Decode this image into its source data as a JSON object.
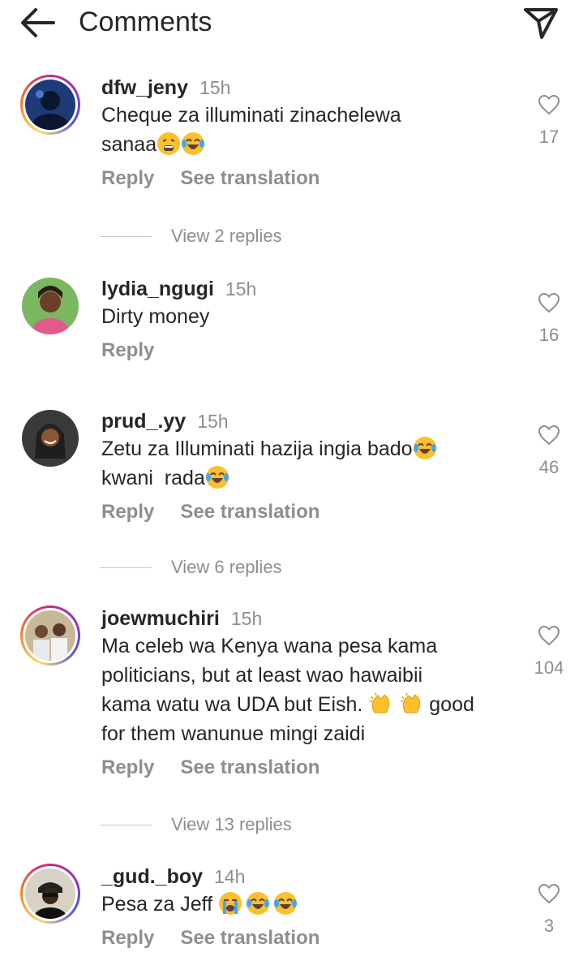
{
  "header": {
    "title": "Comments",
    "back_icon": "arrow-left-icon",
    "send_icon": "paper-plane-icon"
  },
  "colors": {
    "text": "#262626",
    "secondary": "#8e8e8e",
    "divider": "#c7c7c7"
  },
  "comments": [
    {
      "username": "dfw_jeny",
      "time": "15h",
      "lines": [
        "Cheque za illuminati zinachelewa",
        "sanaa"
      ],
      "emojis": [
        "tired-face-emoji",
        "tears-of-joy-emoji"
      ],
      "reply_label": "Reply",
      "translate_label": "See translation",
      "likes": "17",
      "view_replies": "View 2 replies"
    },
    {
      "username": "lydia_ngugi",
      "time": "15h",
      "lines": [
        "Dirty money"
      ],
      "reply_label": "Reply",
      "likes": "16"
    },
    {
      "username": "prud_.yy",
      "time": "15h",
      "lines": [
        "Zetu za Illuminati hazija ingia bado",
        "kwani  rada"
      ],
      "emojis": [
        "tears-of-joy-emoji",
        "tears-of-joy-emoji"
      ],
      "reply_label": "Reply",
      "translate_label": "See translation",
      "likes": "46",
      "view_replies": "View 6 replies"
    },
    {
      "username": "joewmuchiri",
      "time": "15h",
      "lines": [
        "Ma celeb wa Kenya wana pesa kama",
        "politicians, but at least wao hawaibii",
        "kama watu wa UDA but Eish. ",
        " good",
        "for them wanunue mingi zaidi"
      ],
      "emojis": [
        "clapping-hands-emoji",
        "clapping-hands-emoji"
      ],
      "reply_label": "Reply",
      "translate_label": "See translation",
      "likes": "104",
      "view_replies": "View 13 replies"
    },
    {
      "username": "_gud._boy",
      "time": "14h",
      "lines": [
        "Pesa za Jeff "
      ],
      "emojis": [
        "loudly-crying-emoji",
        "tears-of-joy-emoji",
        "tears-of-joy-emoji"
      ],
      "reply_label": "Reply",
      "translate_label": "See translation",
      "likes": "3"
    }
  ]
}
